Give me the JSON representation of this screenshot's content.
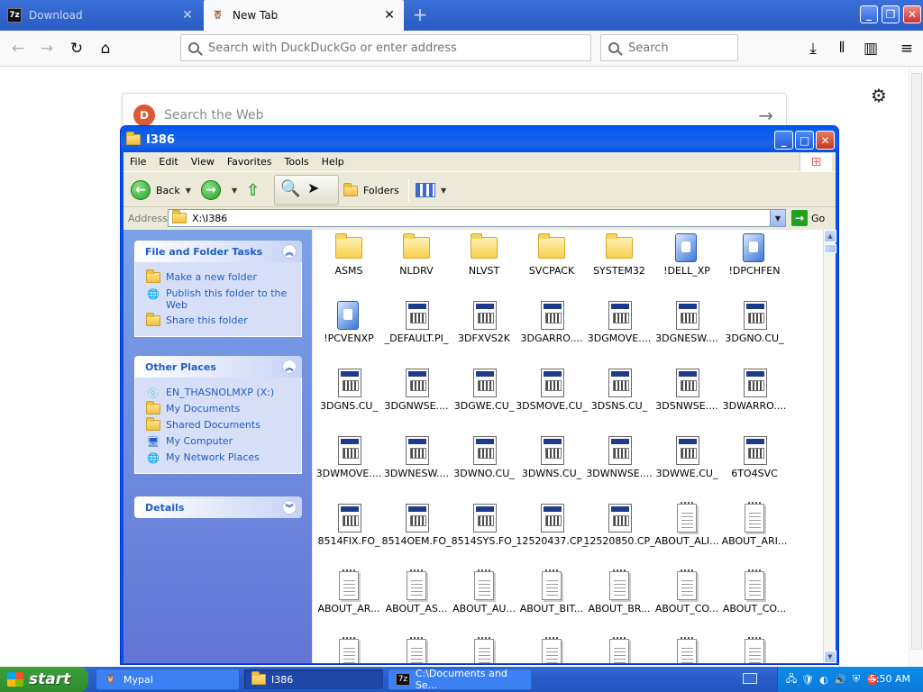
{
  "browser": {
    "tabs": [
      {
        "title": "Download",
        "favicon": "7z",
        "active": false
      },
      {
        "title": "New Tab",
        "favicon": "owl",
        "active": true
      }
    ],
    "url_placeholder": "Search with DuckDuckGo or enter address",
    "search_placeholder": "Search",
    "web_search_placeholder": "Search the Web"
  },
  "explorer": {
    "title": "I386",
    "menu": [
      "File",
      "Edit",
      "View",
      "Favorites",
      "Tools",
      "Help"
    ],
    "toolbar": {
      "back": "Back",
      "folders": "Folders"
    },
    "address_label": "Address",
    "address_value": "X:\\I386",
    "go_label": "Go",
    "panels": {
      "file_tasks": {
        "title": "File and Folder Tasks",
        "items": [
          "Make a new folder",
          "Publish this folder to the Web",
          "Share this folder"
        ]
      },
      "other_places": {
        "title": "Other Places",
        "items": [
          "EN_THASNOLMXP (X:)",
          "My Documents",
          "Shared Documents",
          "My Computer",
          "My Network Places"
        ]
      },
      "details": {
        "title": "Details"
      }
    },
    "files": [
      [
        "ASMS",
        "NLDRV",
        "NLVST",
        "SVCPACK",
        "SYSTEM32",
        "!DELL_XP",
        "!DPCHFEN"
      ],
      [
        "!PCVENXP",
        "_DEFAULT.PI_",
        "3DFXVS2K",
        "3DGARRO....",
        "3DGMOVE....",
        "3DGNESW....",
        "3DGNO.CU_"
      ],
      [
        "3DGNS.CU_",
        "3DGNWSE....",
        "3DGWE.CU_",
        "3DSMOVE.CU_",
        "3DSNS.CU_",
        "3DSNWSE....",
        "3DWARRO...."
      ],
      [
        "3DWMOVE....",
        "3DWNESW....",
        "3DWNO.CU_",
        "3DWNS.CU_",
        "3DWNWSE....",
        "3DWWE.CU_",
        "6TO4SVC"
      ],
      [
        "8514FIX.FO_",
        "8514OEM.FO_",
        "8514SYS.FO_",
        "12520437.CP_",
        "12520850.CP_",
        "ABOUT_ALI...",
        "ABOUT_ARI..."
      ],
      [
        "ABOUT_AR...",
        "ABOUT_AS...",
        "ABOUT_AU...",
        "ABOUT_BIT...",
        "ABOUT_BR...",
        "ABOUT_CO...",
        "ABOUT_CO..."
      ],
      [
        "",
        "",
        "",
        "",
        "",
        "",
        ""
      ]
    ],
    "file_types": [
      [
        "folder",
        "folder",
        "folder",
        "folder",
        "folder",
        "exe",
        "exe"
      ],
      [
        "exe",
        "cab",
        "cab",
        "cab",
        "cab",
        "cab",
        "cab"
      ],
      [
        "cab",
        "cab",
        "cab",
        "cab",
        "cab",
        "cab",
        "cab"
      ],
      [
        "cab",
        "cab",
        "cab",
        "cab",
        "cab",
        "cab",
        "cab"
      ],
      [
        "cab",
        "cab",
        "cab",
        "cab",
        "cab",
        "txt",
        "txt"
      ],
      [
        "txt",
        "txt",
        "txt",
        "txt",
        "txt",
        "txt",
        "txt"
      ],
      [
        "txt",
        "txt",
        "txt",
        "txt",
        "txt",
        "txt",
        "txt"
      ]
    ]
  },
  "taskbar": {
    "start_label": "start",
    "tasks": [
      {
        "label": "Mypal",
        "icon": "owl",
        "active": false
      },
      {
        "label": "I386",
        "icon": "folder",
        "active": true
      },
      {
        "label": "C:\\Documents and Se...",
        "icon": "7z",
        "active": false
      }
    ],
    "clock": "5:50 AM"
  }
}
